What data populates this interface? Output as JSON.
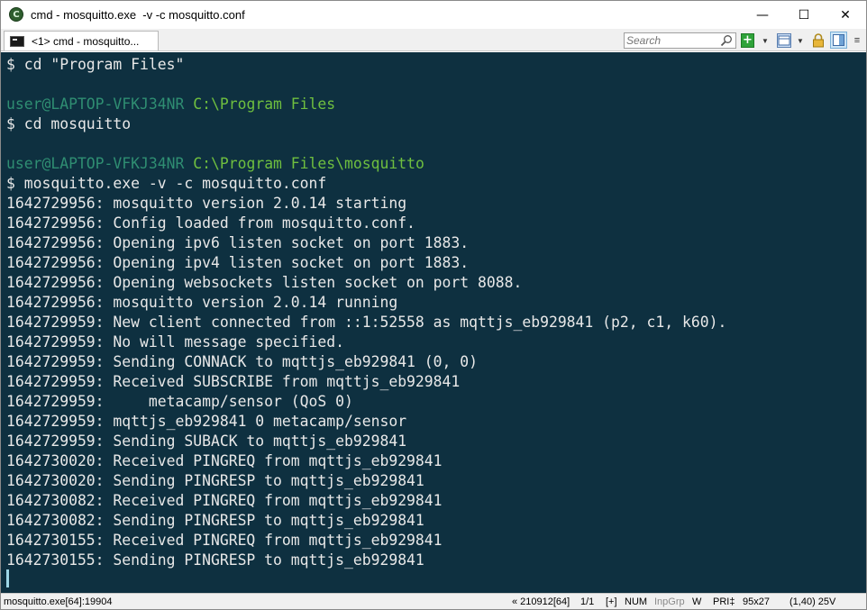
{
  "window": {
    "title": "cmd - mosquitto.exe  -v -c mosquitto.conf",
    "controls": {
      "minimize": "—",
      "maximize": "☐",
      "close": "✕"
    }
  },
  "tabbar": {
    "tab_label": "<1> cmd - mosquitto...",
    "search_placeholder": "Search",
    "plus_label": "+",
    "dropdown_glyph": "▼",
    "menu_glyph": "≡"
  },
  "terminal": {
    "lines": [
      "$ cd \"Program Files\"",
      "",
      "",
      "$ cd mosquitto",
      "",
      "",
      "$ mosquitto.exe -v -c mosquitto.conf",
      "1642729956: mosquitto version 2.0.14 starting",
      "1642729956: Config loaded from mosquitto.conf.",
      "1642729956: Opening ipv6 listen socket on port 1883.",
      "1642729956: Opening ipv4 listen socket on port 1883.",
      "1642729956: Opening websockets listen socket on port 8088.",
      "1642729956: mosquitto version 2.0.14 running",
      "1642729959: New client connected from ::1:52558 as mqttjs_eb929841 (p2, c1, k60).",
      "1642729959: No will message specified.",
      "1642729959: Sending CONNACK to mqttjs_eb929841 (0, 0)",
      "1642729959: Received SUBSCRIBE from mqttjs_eb929841",
      "1642729959:     metacamp/sensor (QoS 0)",
      "1642729959: mqttjs_eb929841 0 metacamp/sensor",
      "1642729959: Sending SUBACK to mqttjs_eb929841",
      "1642730020: Received PINGREQ from mqttjs_eb929841",
      "1642730020: Sending PINGRESP to mqttjs_eb929841",
      "1642730082: Received PINGREQ from mqttjs_eb929841",
      "1642730082: Sending PINGRESP to mqttjs_eb929841",
      "1642730155: Received PINGREQ from mqttjs_eb929841",
      "1642730155: Sending PINGRESP to mqttjs_eb929841"
    ],
    "prompt1": {
      "user": "user@LAPTOP-VFKJ34NR",
      "path": "C:\\Program Files"
    },
    "prompt2": {
      "user": "user@LAPTOP-VFKJ34NR",
      "path": "C:\\Program Files\\mosquitto"
    },
    "colors": {
      "background": "#0e3040",
      "text": "#e8e8e8",
      "user": "#2f8e72",
      "path": "#6fbf3f"
    }
  },
  "statusbar": {
    "process": "mosquitto.exe[64]:19904",
    "build": "« 210912[64]",
    "console_index": "1/1",
    "insert": "[+]",
    "num": "NUM",
    "inpgrp": "InpGrp",
    "w": "W",
    "pri": "PRI‡",
    "size": "95x27",
    "cursor_pos": "(1,40) 25V"
  }
}
